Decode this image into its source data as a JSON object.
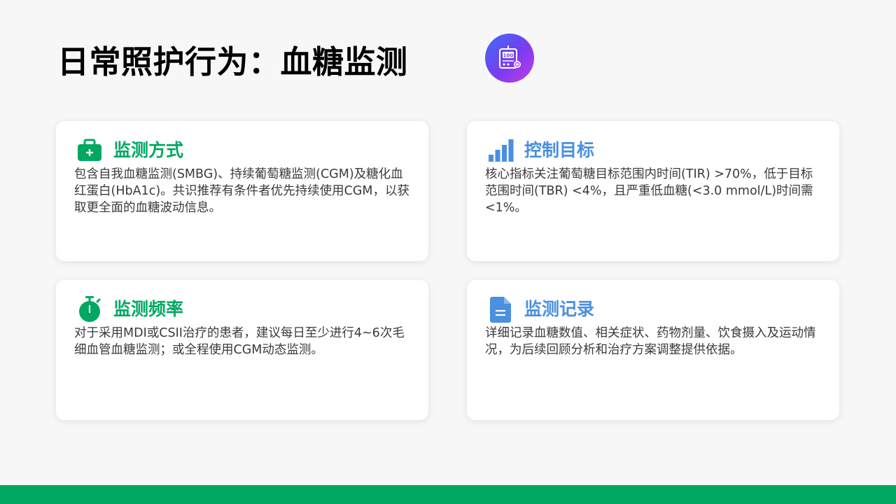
{
  "page": {
    "title": "日常照护行为：血糖监测"
  },
  "colors": {
    "green": "#00a862",
    "blue": "#4a8fe0",
    "badge_gradient": [
      "#3b6ef2",
      "#c63bea"
    ],
    "body_text": "#3a3a3a"
  },
  "hero_icon": {
    "name": "glucose-meter-icon",
    "reading": "100"
  },
  "cards": [
    {
      "icon": "medical-kit-icon",
      "title": "监测方式",
      "title_color": "#00a862",
      "body": "包含自我血糖监测(SMBG)、持续葡萄糖监测(CGM)及糖化血红蛋白(HbA1c)。共识推荐有条件者优先持续使用CGM，以获取更全面的血糖波动信息。"
    },
    {
      "icon": "bar-chart-icon",
      "title": "控制目标",
      "title_color": "#4a8fe0",
      "body": "核心指标关注葡萄糖目标范围内时间(TIR) >70%，低于目标范围时间(TBR) <4%，且严重低血糖(<3.0 mmol/L)时间需<1%。"
    },
    {
      "icon": "stopwatch-icon",
      "title": "监测频率",
      "title_color": "#00a862",
      "body": "对于采用MDI或CSII治疗的患者，建议每日至少进行4~6次毛细血管血糖监测；或全程使用CGM动态监测。"
    },
    {
      "icon": "document-icon",
      "title": "监测记录",
      "title_color": "#4a8fe0",
      "body": "详细记录血糖数值、相关症状、药物剂量、饮食摄入及运动情况，为后续回顾分析和治疗方案调整提供依据。"
    }
  ]
}
